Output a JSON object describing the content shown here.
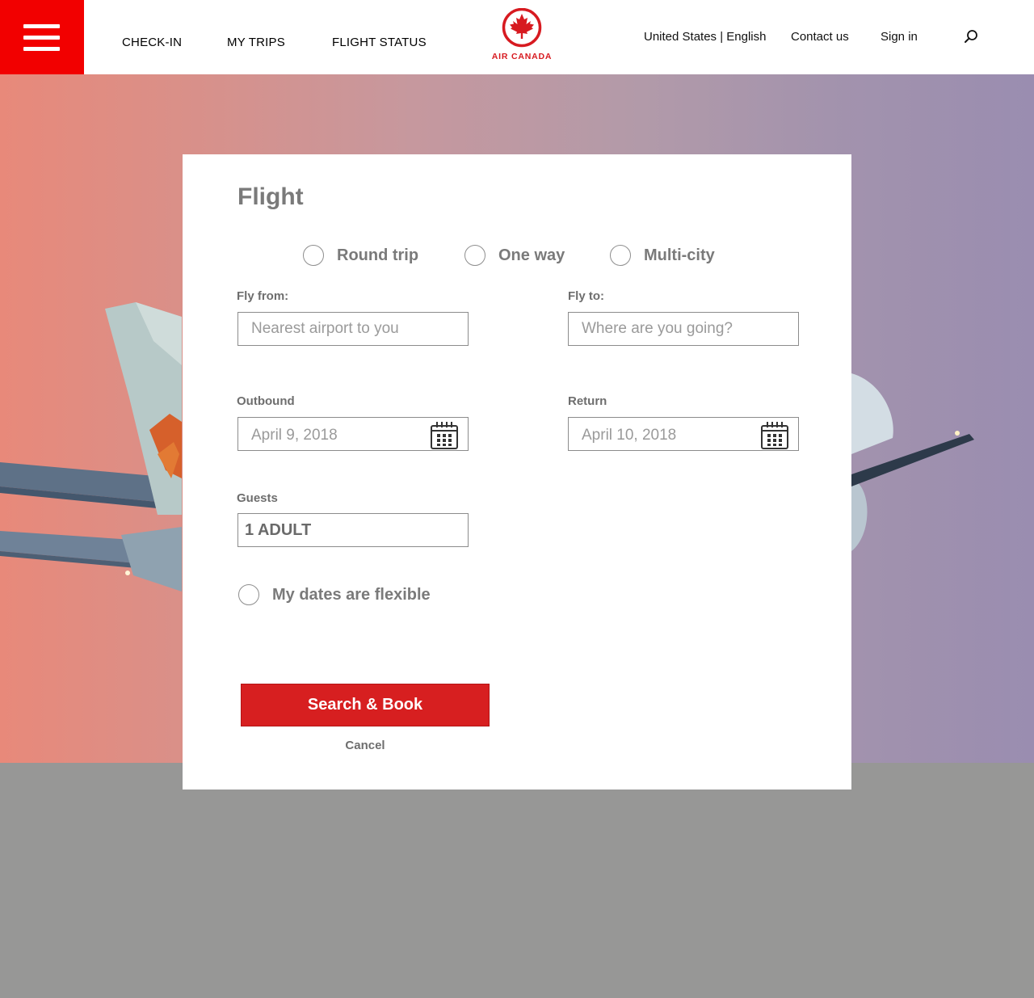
{
  "header": {
    "menu_icon": "hamburger-menu-icon",
    "nav": [
      {
        "label": "CHECK-IN"
      },
      {
        "label": "MY TRIPS"
      },
      {
        "label": "FLIGHT STATUS"
      }
    ],
    "logo_text": "AIR CANADA",
    "locale": "United States | English",
    "contact": "Contact us",
    "signin": "Sign in",
    "search_icon": "search-icon"
  },
  "colors": {
    "brand_red": "#d71f20",
    "menu_red": "#f20000",
    "card_bg": "#ffffff",
    "page_bg": "#979796"
  },
  "booking": {
    "title": "Flight",
    "trip_types": [
      {
        "label": "Round trip"
      },
      {
        "label": "One way"
      },
      {
        "label": "Multi-city"
      }
    ],
    "fly_from": {
      "label": "Fly from:",
      "placeholder": "Nearest airport to you"
    },
    "fly_to": {
      "label": "Fly to:",
      "placeholder": "Where are you going?"
    },
    "outbound": {
      "label": "Outbound",
      "value": "April 9, 2018",
      "icon": "calendar-icon"
    },
    "return": {
      "label": "Return",
      "value": "April 10, 2018",
      "icon": "calendar-icon"
    },
    "guests": {
      "label": "Guests",
      "value": "1 ADULT"
    },
    "flexible": {
      "label": "My dates are flexible"
    },
    "submit": "Search & Book",
    "cancel": "Cancel"
  }
}
